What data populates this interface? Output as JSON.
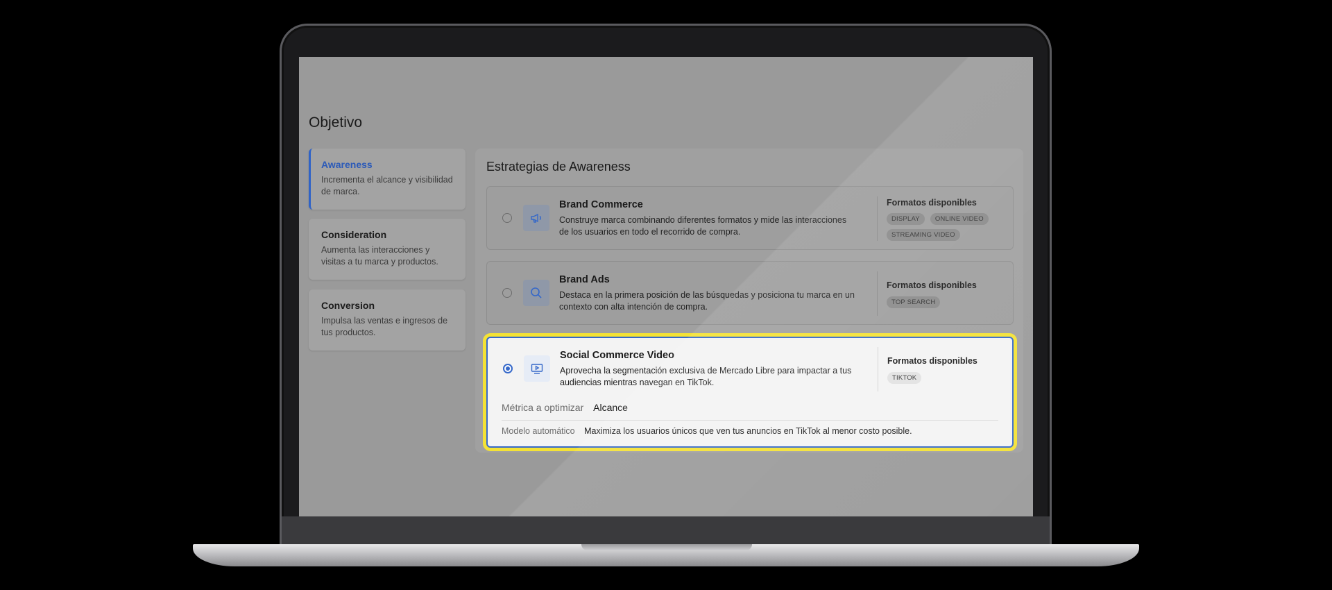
{
  "page": {
    "title": "Objetivo"
  },
  "objectives": [
    {
      "title": "Awareness",
      "description": "Incrementa el alcance y visibilidad de marca.",
      "active": true
    },
    {
      "title": "Consideration",
      "description": "Aumenta las interacciones y visitas a tu marca y productos.",
      "active": false
    },
    {
      "title": "Conversion",
      "description": "Impulsa las ventas e ingresos de tus productos.",
      "active": false
    }
  ],
  "strategies_panel": {
    "title": "Estrategias de Awareness",
    "formats_label": "Formatos disponibles",
    "items": [
      {
        "title": "Brand Commerce",
        "description": "Construye marca combinando diferentes formatos y mide las interacciones de los usuarios en todo el recorrido de compra.",
        "icon": "megaphone-icon",
        "formats": [
          "DISPLAY",
          "ONLINE VIDEO",
          "STREAMING VIDEO"
        ],
        "selected": false
      },
      {
        "title": "Brand Ads",
        "description": "Destaca en la primera posición de las búsquedas y posiciona tu marca en un contexto con alta intención de compra.",
        "icon": "search-icon",
        "formats": [
          "TOP SEARCH"
        ],
        "selected": false
      },
      {
        "title": "Social Commerce Video",
        "description": "Aprovecha la segmentación exclusiva de Mercado Libre para impactar a tus audiencias mientras navegan en TikTok.",
        "icon": "video-play-icon",
        "formats": [
          "TIKTOK"
        ],
        "selected": true,
        "metric_label": "Métrica a optimizar",
        "metric_value": "Alcance",
        "model_label": "Modelo automático",
        "model_description": "Maximiza los usuarios únicos que ven tus anuncios en TikTok al menor costo posible."
      }
    ]
  },
  "colors": {
    "accent": "#3568c9",
    "highlight": "#f4e235"
  }
}
